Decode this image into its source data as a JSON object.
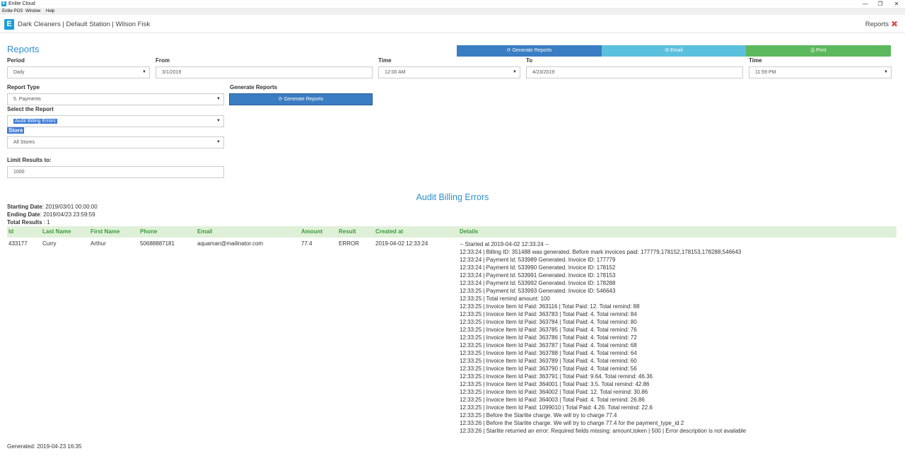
{
  "window": {
    "title": "Enlite Cloud",
    "app_icon": "E",
    "controls": [
      "—",
      "❐",
      "✕"
    ]
  },
  "menu": [
    "Enlite POS",
    "Window",
    "Help"
  ],
  "header": {
    "logo": "E",
    "station_text": "Dark Cleaners | Default Station | Wilson Fisk",
    "reports_link": "Reports",
    "close_icon": "✖"
  },
  "page": {
    "title": "Reports",
    "actions": {
      "generate": "⟳ Generate Reports",
      "email": "✉ Email",
      "print": "⎙ Print"
    }
  },
  "form": {
    "period": {
      "label": "Period",
      "value": "Daily"
    },
    "from": {
      "label": "From",
      "value": "3/1/2019"
    },
    "time_from": {
      "label": "Time",
      "value": "12:00 AM"
    },
    "to": {
      "label": "To",
      "value": "4/23/2019"
    },
    "time_to": {
      "label": "Time",
      "value": "11:59 PM"
    },
    "report_type": {
      "label": "Report Type",
      "value": "5. Payments"
    },
    "generate": {
      "label": "Generate Reports",
      "button": "⟳ Generate Reports"
    },
    "select_report": {
      "label": "Select the Report",
      "value": "Audit Billing Errors"
    },
    "store": {
      "label": "Store",
      "value": "All Stores"
    },
    "limit": {
      "label": "Limit Results to:",
      "value": "1000"
    }
  },
  "report": {
    "title": "Audit Billing Errors",
    "starting_label": "Starting Date",
    "starting_value": ": 2019/03/01 00:00:00",
    "ending_label": "Ending Date",
    "ending_value": ": 2019/04/23 23:59:59",
    "total_label": "Total Results",
    "total_value": " : 1",
    "columns": [
      "Id",
      "Last Name",
      "First Name",
      "Phone",
      "Email",
      "Amount",
      "Result",
      "Created at",
      "Details"
    ],
    "row": {
      "id": "433177",
      "last_name": "Curry",
      "first_name": "Arthur",
      "phone": "50688887181",
      "email": "aquaman@mailinator.com",
      "amount": "77.4",
      "result": "ERROR",
      "created_at": "2019-04-02 12:33:24",
      "details": [
        "-- Started at 2019-04-02 12:33:24 --",
        "12:33:24 | Billing ID: 351488 was generated. Before mark invoices paid: 177779,178152,178153,178288,546643",
        "12:33:24 | Payment Id: 533989 Generated. Invoice ID: 177779",
        "12:33:24 | Payment Id: 533990 Generated. Invoice ID: 178152",
        "12:33:24 | Payment Id: 533991 Generated. Invoice ID: 178153",
        "12:33:24 | Payment Id: 533992 Generated. Invoice ID: 178288",
        "12:33:25 | Payment Id: 533993 Generated. Invoice ID: 546643",
        "12:33:25 | Total remind amount: 100",
        "12:33:25 | Invoice Item Id Paid: 363116 | Total Paid: 12. Total remind: 88",
        "12:33:25 | Invoice Item Id Paid: 363783 | Total Paid: 4. Total remind: 84",
        "12:33:25 | Invoice Item Id Paid: 363784 | Total Paid: 4. Total remind: 80",
        "12:33:25 | Invoice Item Id Paid: 363785 | Total Paid: 4. Total remind: 76",
        "12:33:25 | Invoice Item Id Paid: 363786 | Total Paid: 4. Total remind: 72",
        "12:33:25 | Invoice Item Id Paid: 363787 | Total Paid: 4. Total remind: 68",
        "12:33:25 | Invoice Item Id Paid: 363788 | Total Paid: 4. Total remind: 64",
        "12:33:25 | Invoice Item Id Paid: 363789 | Total Paid: 4. Total remind: 60",
        "12:33:25 | Invoice Item Id Paid: 363790 | Total Paid: 4. Total remind: 56",
        "12:33:25 | Invoice Item Id Paid: 363791 | Total Paid: 9.64. Total remind: 46.36",
        "12:33:25 | Invoice Item Id Paid: 364001 | Total Paid: 3.5. Total remind: 42.86",
        "12:33:25 | Invoice Item Id Paid: 364002 | Total Paid: 12. Total remind: 30.86",
        "12:33:25 | Invoice Item Id Paid: 364003 | Total Paid: 4. Total remind: 26.86",
        "12:33:25 | Invoice Item Id Paid: 1099010 | Total Paid: 4.26. Total remind: 22.6",
        "12:33:25 | Before the Starlite charge. We will try to charge 77.4",
        "12:33:26 | Before the Starlite charge. We will try to charge 77.4 for the payment_type_id 2",
        "12:33:26 | Starlite returned an error: Required fields missing: amount,token | 500 | Error description is not available"
      ]
    },
    "generated": "Generated: 2019-04-23 16:35"
  },
  "icons": {
    "refresh": "refresh-icon",
    "email": "envelope-icon",
    "print": "printer-icon",
    "caret": "chevron-down-icon",
    "close": "close-icon"
  },
  "colors": {
    "accent": "#2e8fcb",
    "generate_btn": "#3a7dc2",
    "email_btn": "#5bc0de",
    "print_btn": "#5cb85c",
    "table_header_bg": "#dff0d8",
    "close": "#d9534f"
  }
}
